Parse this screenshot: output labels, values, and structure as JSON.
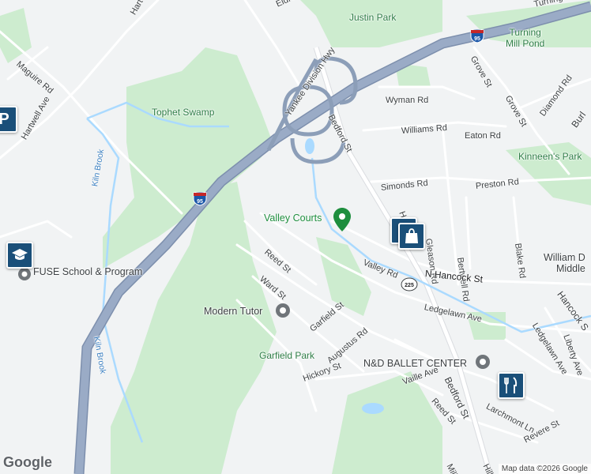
{
  "map": {
    "roads": {
      "eldred": "Eldred St",
      "hartwell_top": "Hartwell",
      "maguire": "Maguire Rd",
      "hartwell_ave": "Hartwell Ave",
      "yankee": "Yankee Division Hwy",
      "bedford_top": "Bedford St",
      "wyman": "Wyman Rd",
      "williams": "Williams Rd",
      "eaton": "Eaton Rd",
      "simonds": "Simonds Rd",
      "preston": "Preston Rd",
      "gleason": "Gleason Rd",
      "bertwell": "Bertwell Rd",
      "blake": "Blake Rd",
      "valley": "Valley Rd",
      "n_hancock": "N Hancock St",
      "ledgelawn1": "Ledgelawn Ave",
      "reed_top": "Reed St",
      "ward": "Ward St",
      "garfield": "Garfield St",
      "augustus": "Augustus Rd",
      "hickory": "Hickory St",
      "vaille": "Vaille Ave",
      "reed_bottom": "Reed St",
      "bedford_bottom": "Bedford St",
      "larchmont": "Larchmont Ln",
      "revere": "Revere St",
      "milk": "Milk St",
      "hill": "Hill St",
      "grove1": "Grove St",
      "grove2": "Grove St",
      "diamond": "Diamond Rd",
      "burl": "Burl",
      "hancock_right": "Hancock S",
      "ledgelawn2": "Ledgelawn Ave",
      "liberty": "Liberty Ave",
      "turning": "Turning M",
      "ho": "Ho"
    },
    "water": {
      "kiln1": "Kiln Brook",
      "kiln2": "Kiln Brook"
    },
    "parks": {
      "justin": "Justin Park",
      "turning_mill": "Turning\nMill Pond",
      "tophet": "Tophet Swamp",
      "kinneen": "Kinneen's Park",
      "garfield": "Garfield Park"
    },
    "pois": {
      "valley_courts": "Valley Courts",
      "modern_tutor": "Modern Tutor",
      "nd_ballet": "N&D BALLET CENTER",
      "fuse": "FUSE School & Program",
      "william": "William D",
      "middle": "Middle"
    },
    "shields": {
      "i95_top": "95",
      "i95_mid": "95",
      "r225": "225"
    },
    "footer": {
      "logo": "Google",
      "attribution": "Map data ©2026 Google"
    },
    "colors": {
      "background": "#f1f3f4",
      "park": "#cdeccf",
      "highway": "#8c9eb8",
      "water": "#aadaff",
      "road": "#ffffff",
      "pin_green": "#1e8e3e",
      "pin_gray": "#70757a",
      "tile_blue": "#1a4f79"
    }
  }
}
